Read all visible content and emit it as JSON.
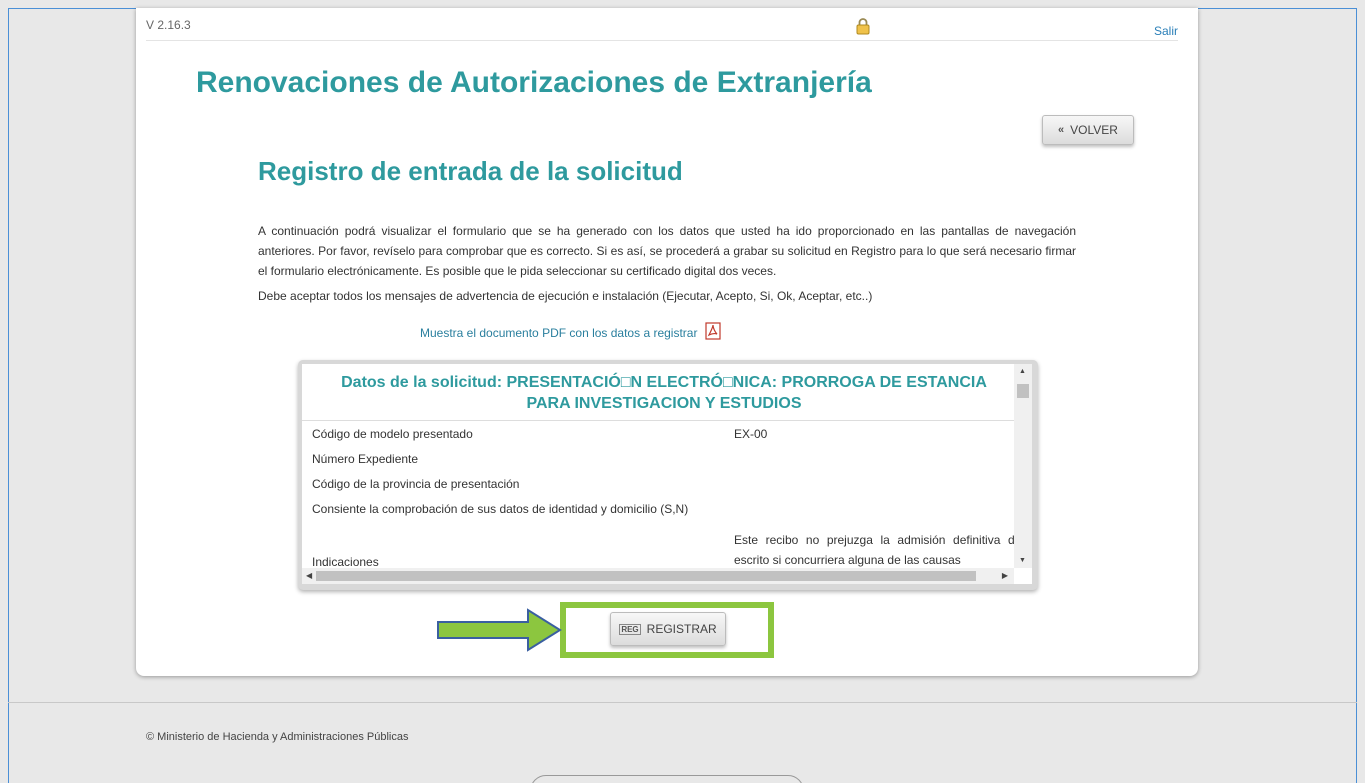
{
  "header": {
    "version": "V 2.16.3",
    "logout_label": "Salir",
    "lock_icon": "lock-icon"
  },
  "app_title": "Renovaciones de Autorizaciones de Extranjería",
  "back_button": {
    "label": "VOLVER",
    "icon": "double-chevron-left-icon"
  },
  "section_title": "Registro de entrada de la solicitud",
  "intro_paragraph": "A continuación podrá visualizar el formulario que se ha generado con los datos que usted ha ido proporcionado en las pantallas de navegación anteriores. Por favor, revíselo para comprobar que es correcto. Si es así, se procederá a grabar su solicitud en Registro para lo que será necesario firmar el formulario electrónicamente. Es posible que le pida seleccionar su certificado digital dos veces.",
  "warning_paragraph": "Debe aceptar todos los mensajes de advertencia de ejecución e instalación (Ejecutar, Acepto, Si, Ok, Aceptar, etc..)",
  "pdf_link": {
    "label": "Muestra el documento PDF con los datos a registrar",
    "icon": "pdf-icon"
  },
  "panel": {
    "title": "Datos de la solicitud: PRESENTACIÓ□N ELECTRÓ□NICA: PRORROGA DE ESTANCIA PARA INVESTIGACION Y ESTUDIOS",
    "rows": [
      {
        "label": "Código de modelo presentado",
        "value": "EX-00"
      },
      {
        "label": "Número Expediente",
        "value": ""
      },
      {
        "label": "Código de la provincia de presentación",
        "value": ""
      },
      {
        "label": "Consiente la comprobación de sus datos de identidad y domicilio (S,N)",
        "value": ""
      }
    ],
    "indications_label": "Indicaciones",
    "indications_text": "Este recibo no prejuzga la admisión definitiva del escrito si concurriera alguna de las causas"
  },
  "register_button": {
    "label": "REGISTRAR",
    "icon_text": "REG"
  },
  "accent_colors": {
    "title_teal": "#2e9a9e",
    "highlight_green": "#8cc63f",
    "arrow_green": "#8cc63f",
    "arrow_outline": "#3a5fa0"
  },
  "footer": {
    "copyright": "© Ministerio de Hacienda y Administraciones Públicas"
  }
}
